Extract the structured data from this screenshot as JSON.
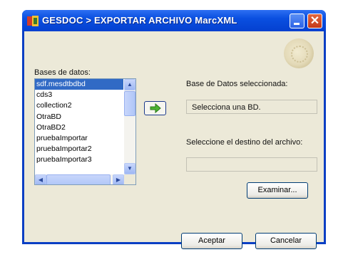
{
  "window": {
    "title": "GESDOC > EXPORTAR ARCHIVO MarcXML",
    "icons": {
      "app": "gesdoc-app-icon",
      "minimize": "minimize-icon",
      "close": "close-icon"
    },
    "close_glyph": "✕"
  },
  "databases": {
    "label": "Bases de datos:",
    "items": [
      "sdf.mesdtbdbd",
      "cds3",
      "collection2",
      "OtraBD",
      "OtraBD2",
      "pruebaImportar",
      "pruebaImportar2",
      "pruebaImportar3"
    ],
    "selected_index": 0,
    "scroll_icons": {
      "up": "scroll-up-arrow-icon",
      "down": "scroll-down-arrow-icon",
      "left": "scroll-left-arrow-icon",
      "right": "scroll-right-arrow-icon"
    }
  },
  "transfer_button": {
    "icon": "green-right-arrow-icon"
  },
  "selected_db": {
    "label": "Base de Datos seleccionada:",
    "value": "Selecciona una BD."
  },
  "destination": {
    "label": "Seleccione el destino del archivo:",
    "value": "",
    "browse_label": "Examinar..."
  },
  "actions": {
    "accept_label": "Aceptar",
    "cancel_label": "Cancelar"
  },
  "colors": {
    "titlebar": "#0a4fe0",
    "selection": "#316ac5",
    "client": "#ece9d8",
    "close": "#c4391a"
  }
}
